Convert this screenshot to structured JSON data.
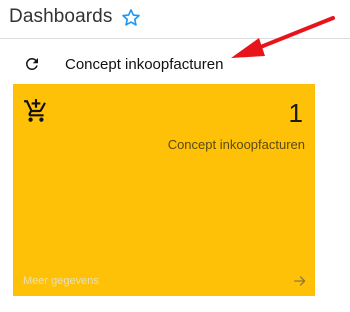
{
  "header": {
    "title": "Dashboards",
    "favorite_icon": "star-outline-icon",
    "accent": "#2196f3"
  },
  "toolbar": {
    "refresh_icon": "refresh-icon",
    "label": "Concept inkoopfacturen"
  },
  "annotation": {
    "arrow_color": "#e8141c"
  },
  "tile": {
    "icon": "cart-plus-icon",
    "count": "1",
    "label": "Concept inkoopfacturen",
    "more_label": "Meer gegevens",
    "more_icon": "arrow-right-icon",
    "background": "#ffc107"
  }
}
